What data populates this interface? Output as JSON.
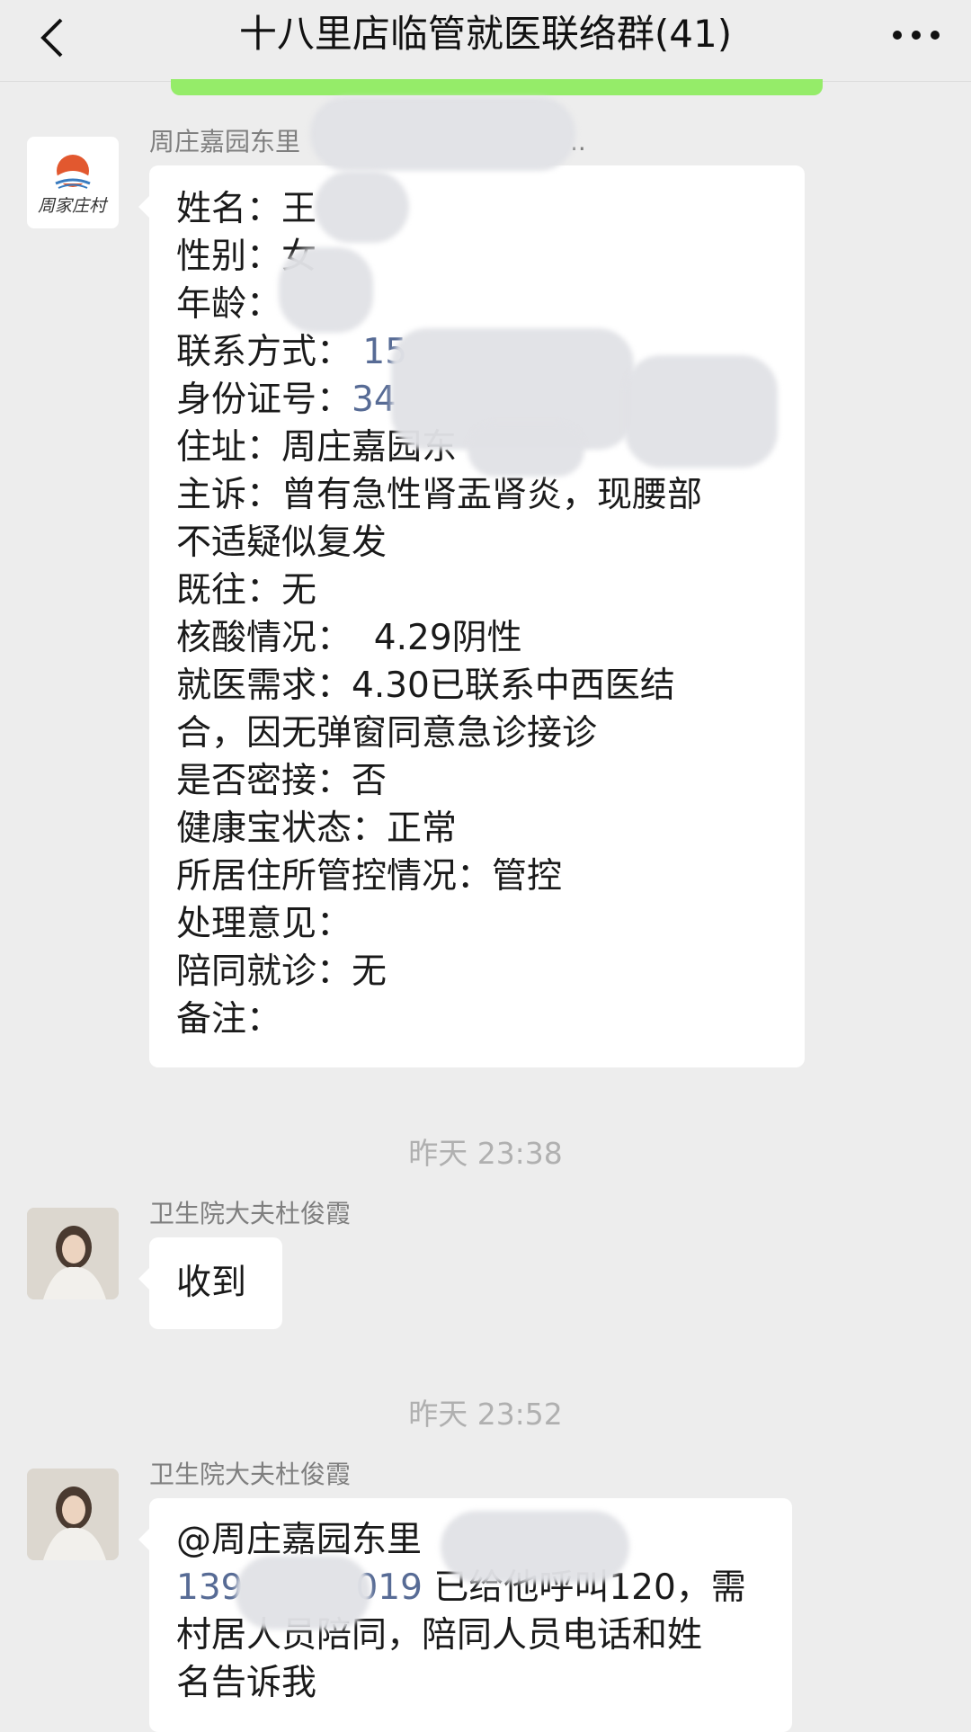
{
  "header": {
    "title": "十八里店临管就医联络群(41)",
    "back_icon": "chevron-left-icon",
    "more_icon": "more-dots-icon"
  },
  "messages": [
    {
      "sender": "周庄嘉园东里",
      "sender_suffix": "..",
      "avatar": "周家庄村",
      "lines": [
        "姓名：王",
        "性别：女",
        "年龄：",
        "联系方式：",
        "身份证号：",
        "住址：周庄嘉园东",
        "主诉：曾有急性肾盂肾炎，现腰部",
        "不适疑似复发",
        "既往：无",
        "核酸情况：  4.29阴性",
        "就医需求：4.30已联系中西医结",
        "合，因无弹窗同意急诊接诊",
        "是否密接：否",
        "健康宝状态：正常",
        "所居住所管控情况：管控",
        "处理意见：",
        "陪同就诊：无",
        "备注："
      ],
      "phone_prefix": "15",
      "id_prefix": "34"
    },
    {
      "time": "昨天 23:38",
      "sender": "卫生院大夫杜俊霞",
      "text": "收到"
    },
    {
      "time": "昨天 23:52",
      "sender": "卫生院大夫杜俊霞",
      "mention": "@周庄嘉园东里",
      "phone_start": "139",
      "phone_end": "019",
      "line2_rest": "已给他呼叫120，需",
      "line3": "村居人员陪同，陪同人员电话和姓",
      "line4": "名告诉我"
    }
  ]
}
